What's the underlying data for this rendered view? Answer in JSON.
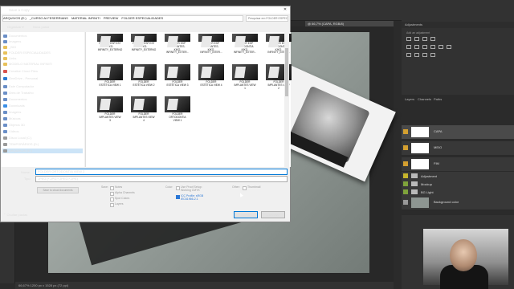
{
  "dialog": {
    "title": "Save a Copy",
    "close_glyph": "✕",
    "breadcrumb": [
      "ARQUIVOS (E:)",
      "_CURSO AI FESERRIANS",
      "MATERIAL INFINITI",
      "PREVIEW",
      "FOLDER ESPECIALIDADES"
    ],
    "search_placeholder": "Pesquisar em FOLDER ESPEC...",
    "organize": "Organizar ▾",
    "new_folder": "Nova pasta",
    "nav_items": [
      {
        "label": "Documentos",
        "color": "#6b8fc7"
      },
      {
        "label": "Imagens",
        "color": "#6b8fc7"
      },
      {
        "label": "_BIO",
        "color": "#e8c15a"
      },
      {
        "label": "FOLDER ESPECIALIDADES",
        "color": "#e8c15a"
      },
      {
        "label": "Links",
        "color": "#e8c15a"
      },
      {
        "label": "MODELO MATERIAL INFINITI",
        "color": "#e8c15a"
      },
      {
        "label": "Creative Cloud Files",
        "color": "#d9544f"
      },
      {
        "label": "OneDrive - Personal",
        "color": "#2b7cd3"
      },
      {
        "label": "Este Computador",
        "color": "#6b8fc7"
      },
      {
        "label": "Área de Trabalho",
        "color": "#6b8fc7"
      },
      {
        "label": "Documentos",
        "color": "#6b8fc7"
      },
      {
        "label": "Downloads",
        "color": "#3a8ee6"
      },
      {
        "label": "Imagens",
        "color": "#6b8fc7"
      },
      {
        "label": "Músicas",
        "color": "#6b8fc7"
      },
      {
        "label": "Objetos 3D",
        "color": "#6b8fc7"
      },
      {
        "label": "Vídeos",
        "color": "#6b8fc7"
      },
      {
        "label": "Disco Local (C:)",
        "color": "#9a9a9a"
      },
      {
        "label": "TEMPORÁRIOS (D:)",
        "color": "#9a9a9a"
      },
      {
        "label": "ARQUIVOS (E:)",
        "color": "#9a9a9a"
      }
    ],
    "files_top": [
      [
        "FOLDER ESP EST",
        "KIKO-",
        "INFINITY_EXTERNO"
      ],
      [
        "FOLDER ESP EST",
        "KIKO-",
        "INFINITY_EXTERNO"
      ],
      [
        "FOLDER ESP",
        "IMPLANTES-",
        "KIKO-",
        "INFINITY_EXTER..."
      ],
      [
        "FOLDER ESP",
        "IMPLANTES-",
        "KIKO-",
        "INFINITY_INTER..."
      ],
      [
        "FOLDER ESP",
        "ORTODONTIA",
        "KIKO-",
        "INFINITY_EXTER..."
      ],
      [
        "FOLDER ESP",
        "ORTODONTIA",
        "KIKO-",
        "INFINITY_INTER..."
      ]
    ],
    "files_mid": [
      [
        "FOLDER",
        "ESTÉTICA VIEW 1"
      ],
      [
        "FOLDER",
        "ESTÉTICA VIEW 2"
      ],
      [
        "FOLDER",
        "ESTÉTICA VIEW 3"
      ],
      [
        "FOLDER",
        "ESTÉTICA VIEW 4"
      ],
      [
        "FOLDER",
        "IMPLANTES VIEW",
        "1"
      ],
      [
        "FOLDER",
        "IMPLANTES VIEW",
        "2"
      ]
    ],
    "files_bot": [
      [
        "FOLDER",
        "IMPLANTES VIEW",
        "3"
      ],
      [
        "FOLDER",
        "IMPLANTES VIEW",
        "4"
      ],
      [
        "FOLDER",
        "ORTODONTIA",
        "VIEW 1"
      ]
    ],
    "name_label": "Nome:",
    "name_value": "FOLDER ORTODONTIA VIEW 2",
    "type_label": "Tipo:",
    "type_value": "JPEG (*.JPG;*.JPEG;*.JPE)",
    "cloud_button": "Save to cloud documents",
    "save_section": "Save:",
    "save_options": [
      "Notes",
      "Alpha Channels",
      "Spot Colors",
      "Layers"
    ],
    "color_section": "Color:",
    "color_options": [
      "Use Proof Setup:",
      "Working CMYK",
      "ICC Profile: sRGB",
      "IEC61966-2.1"
    ],
    "other_section": "Other:",
    "thumbnail": "Thumbnail",
    "save_button": "Salvar",
    "cancel_button": "Cancelar",
    "hide_folders": "Ocultar pastas"
  },
  "photoshop": {
    "doc_tab": "@ 66,7% (CAPA, RGB/8)",
    "status": "66,67%    1200 px x 1528 px (72 ppi)",
    "panel_tabs": [
      "Adjustments"
    ],
    "add_adjustment": "Add an adjustment",
    "layers_tabs": [
      "Layers",
      "Channels",
      "Paths"
    ],
    "layers": [
      {
        "label": "CAPA",
        "kind": "layer"
      },
      {
        "label": "MEIO",
        "kind": "layer"
      },
      {
        "label": "FIM",
        "kind": "layer"
      },
      {
        "label": "Adjustment",
        "kind": "folder"
      },
      {
        "label": "Mockup",
        "kind": "folder"
      },
      {
        "label": "BG Light",
        "kind": "folder"
      },
      {
        "label": "Background color",
        "kind": "bg"
      }
    ]
  }
}
